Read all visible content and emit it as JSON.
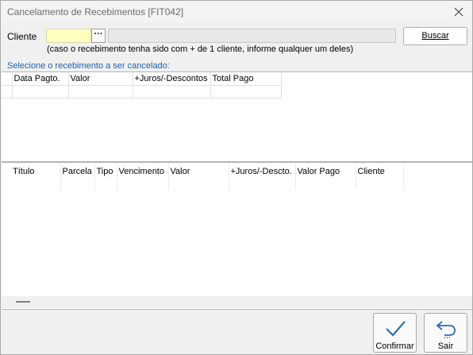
{
  "window": {
    "title": "Cancelamento de Recebimentos [FIT042]"
  },
  "cliente": {
    "label": "Cliente",
    "lookup_button": "···",
    "hint": "(caso o recebimento tenha sido com + de 1 cliente, informe qualquer um deles)",
    "buscar_label": "Buscar",
    "input_color": "#ffffc0"
  },
  "selection_label": "Selecione o recebimento a ser cancelado:",
  "grid_recebimentos": {
    "columns": [
      "Data Pagto.",
      "Valor",
      "+Juros/-Descontos",
      "Total Pago"
    ]
  },
  "grid_titulos": {
    "columns": [
      "Título",
      "Parcela",
      "Tipo",
      "Vencimento",
      "Valor",
      "+Juros/-Descto.",
      "Valor Pago",
      "Cliente"
    ]
  },
  "footer": {
    "confirmar_label": "Confirmar",
    "sair_label": "Sair"
  },
  "colors": {
    "accent": "#1a5fb4",
    "confirm_icon": "#2a6fb0"
  }
}
